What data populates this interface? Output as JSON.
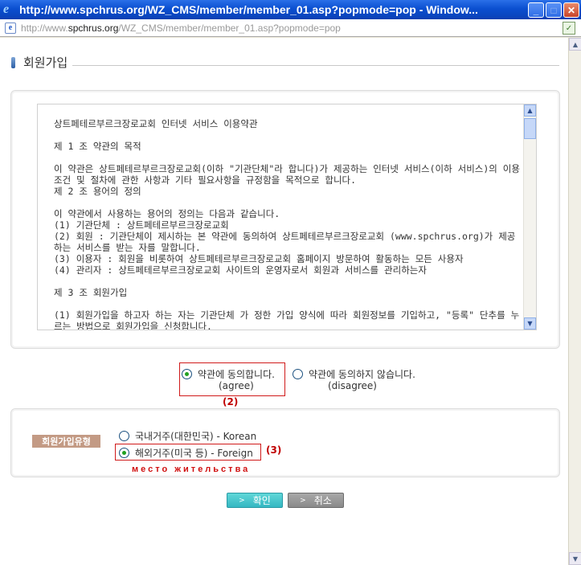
{
  "window": {
    "title": "http://www.spchrus.org/WZ_CMS/member/member_01.asp?popmode=pop - Window...",
    "minimize": "_",
    "maximize": "□",
    "close": "✕"
  },
  "address": {
    "prefix": "http://www.",
    "domain": "spchrus.org",
    "path": "/WZ_CMS/member/member_01.asp?popmode=pop"
  },
  "page": {
    "heading": "회원가입",
    "terms_text": "상트페테르부르크장로교회 인터넷 서비스 이용약관\n\n제 1 조 약관의 목적\n\n이 약관은 상트페테르부르크장로교회(이하 \"기관단체\"라 합니다)가 제공하는 인터넷 서비스(이하 서비스)의 이용조건 및 절차에 관한 사항과 기타 필요사항을 규정함을 목적으로 합니다.\n제 2 조 용어의 정의\n\n이 약관에서 사용하는 용어의 정의는 다음과 같습니다.\n(1) 기관단체 : 상트페테르부르크장로교회\n(2) 회원 : 기관단체이 제시하는 본 약관에 동의하여 상트페테르부르크장로교회 (www.spchrus.org)가 제공하는 서비스를 받는 자를 말합니다.\n(3) 이용자 : 회원을 비롯하여 상트페테르부르크장로교회 홈페이지 방문하여 활동하는 모든 사용자\n(4) 관리자 : 상트페테르부르크장로교회 사이트의 운영자로서 회원과 서비스를 관리하는자\n\n제 3 조 회원가입\n\n(1) 회원가입을 하고자 하는 자는 기관단체 가 정한 가입 양식에 따라 회원정보를 기입하고, \"등록\" 단추를 누르는 방법으로 회원가입을 신청합니다.",
    "agree_label": "약관에 동의합니다.",
    "agree_note": "(agree)",
    "disagree_label": "약관에 동의하지 않습니다.",
    "disagree_note": "(disagree)",
    "marker_2": "(2)",
    "member_type_label": "회원가입유형",
    "korean_option": "국내거주(대한민국) - Korean",
    "foreign_option": "해외거주(미국 등) - Foreign",
    "marker_3": "(3)",
    "russian_note": "место жительства",
    "confirm_button": "확인",
    "cancel_button": "취소"
  },
  "state": {
    "agree_selected": true,
    "foreign_selected": true
  }
}
